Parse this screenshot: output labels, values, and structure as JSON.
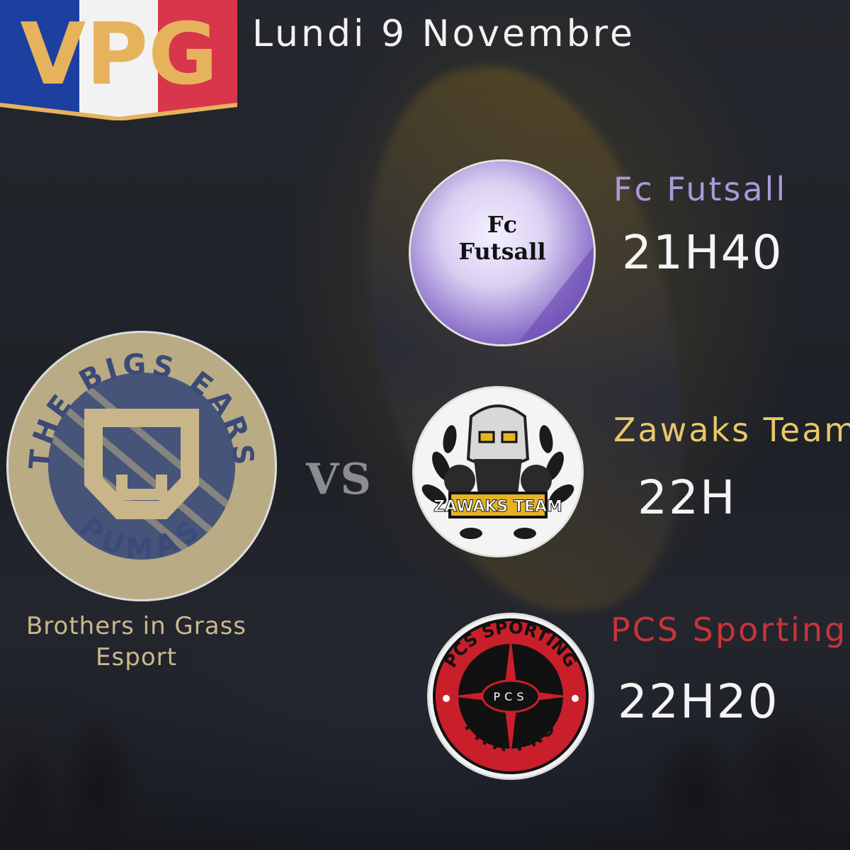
{
  "header": {
    "logo_text": "VPG",
    "date": "Lundi 9 Novembre"
  },
  "home_team": {
    "name": "Brothers in Grass Esport",
    "logo_text_top": "THE BIGS EARS",
    "logo_text_bottom": "PUMAS"
  },
  "vs_label": "VS",
  "matches": [
    {
      "opponent": "Fc Futsall",
      "time": "21H40",
      "logo_text": "Fc Futsall",
      "color": "#a99ad8"
    },
    {
      "opponent": "Zawaks Team",
      "time": "22H",
      "logo_text": "ZAWAKS TEAM",
      "color": "#e8c86a"
    },
    {
      "opponent": "PCS Sporting",
      "time": "22H20",
      "logo_text_top": "PCS SPORTING",
      "logo_text_bottom": "FIFA PRO",
      "logo_center": "PCS",
      "color": "#c8343a"
    }
  ],
  "colors": {
    "flag_blue": "#1d3fa0",
    "flag_white": "#f2f2f2",
    "flag_red": "#d8364a",
    "logo_gold": "#e6b25c"
  }
}
